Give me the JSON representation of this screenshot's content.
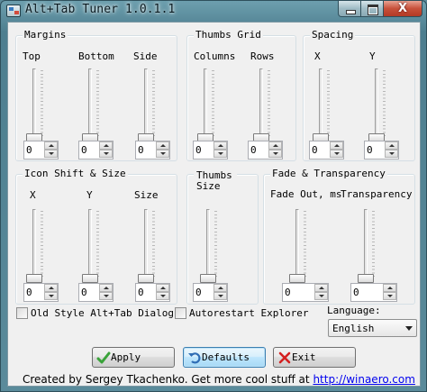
{
  "window": {
    "title": "Alt+Tab Tuner 1.0.1.1",
    "close_glyph": "X"
  },
  "margins": {
    "title": "Margins",
    "labels": [
      "Top",
      "Bottom",
      "Side"
    ],
    "values": [
      "0",
      "0",
      "0"
    ]
  },
  "thumbs_grid": {
    "title": "Thumbs Grid",
    "labels": [
      "Columns",
      "Rows"
    ],
    "values": [
      "0",
      "0"
    ]
  },
  "spacing": {
    "title": "Spacing",
    "labels": [
      "X",
      "Y"
    ],
    "values": [
      "0",
      "0"
    ]
  },
  "icon_shift": {
    "title": "Icon Shift & Size",
    "labels": [
      "X",
      "Y",
      "Size"
    ],
    "values": [
      "0",
      "0",
      "0"
    ]
  },
  "thumbs_size": {
    "title": "Thumbs Size",
    "value": "0"
  },
  "fade": {
    "title": "Fade & Transparency",
    "labels": [
      "Fade Out, ms",
      "Transparency"
    ],
    "values": [
      "0",
      "0"
    ]
  },
  "options": {
    "old_style": "Old Style Alt+Tab Dialog",
    "autorestart": "Autorestart Explorer",
    "language_label": "Language:",
    "language_value": "English"
  },
  "buttons": {
    "apply": "Apply",
    "defaults": "Defaults",
    "exit": "Exit"
  },
  "footer": {
    "text": "Created by Sergey Tkachenko. Get more cool stuff at",
    "link": "http://winaero.com"
  },
  "colors": {
    "apply_check": "#3aa33a",
    "exit_x": "#d42020",
    "defaults_icon": "#2f6db5"
  }
}
